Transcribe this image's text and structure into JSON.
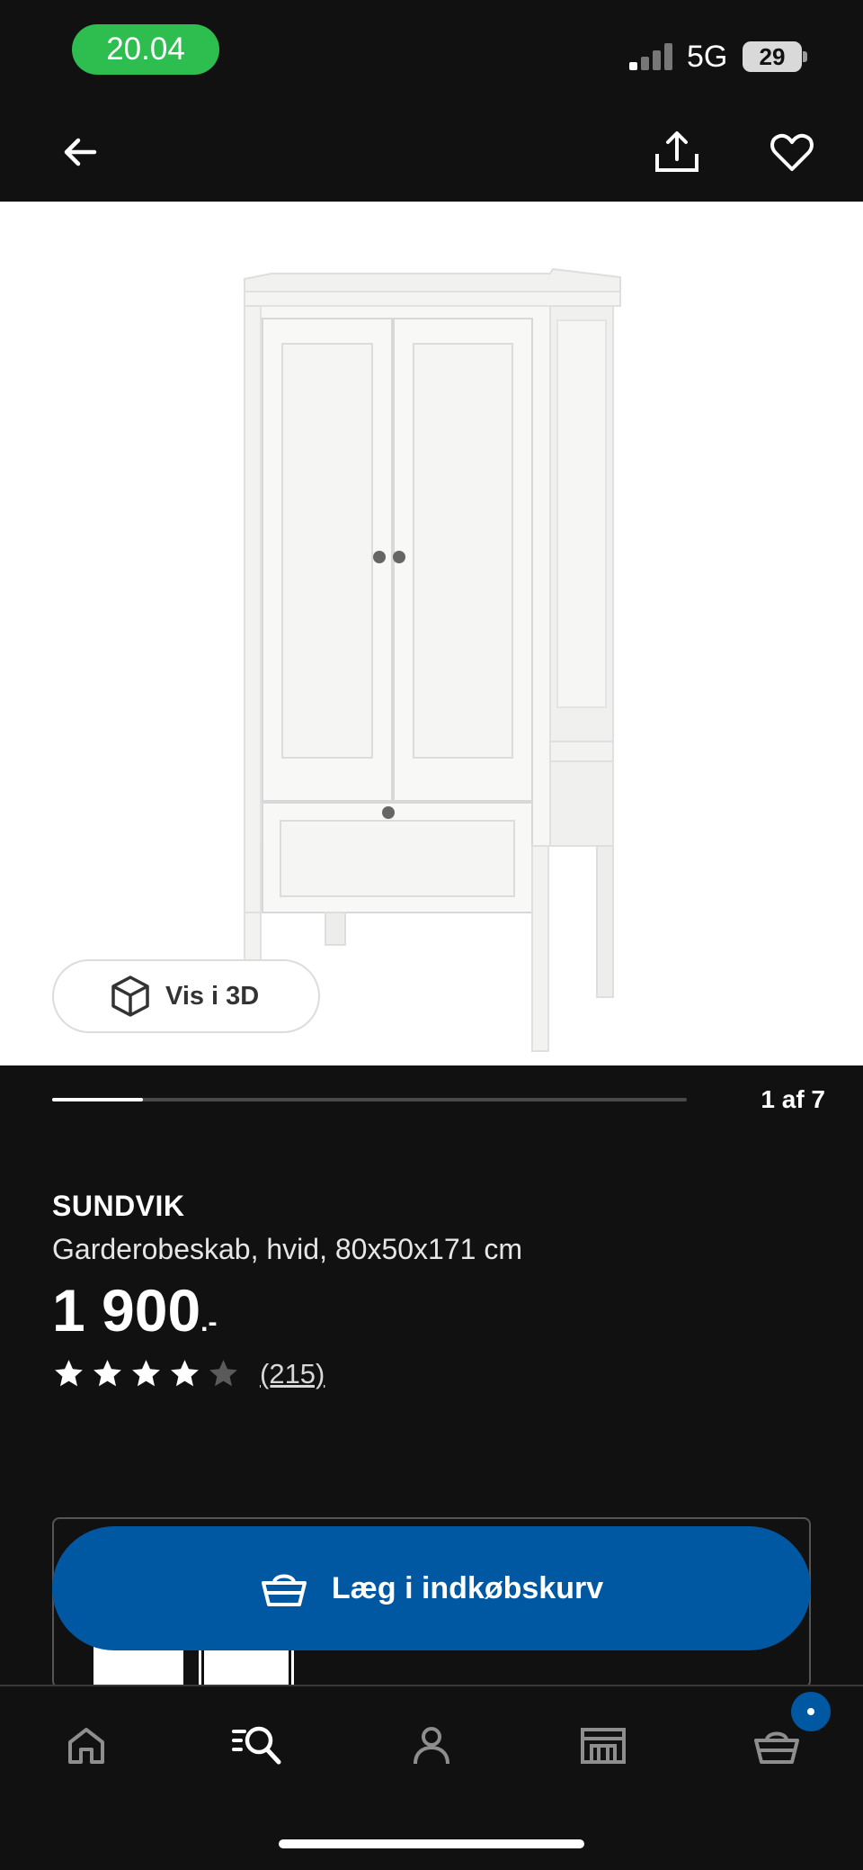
{
  "status_bar": {
    "time": "20.04",
    "network": "5G",
    "battery": "29",
    "time_pill_color": "#2ebd4f"
  },
  "header": {
    "back_icon": "arrow-left-icon",
    "share_icon": "share-icon",
    "favorite_icon": "heart-icon"
  },
  "gallery": {
    "view_3d_label": "Vis i 3D",
    "view_3d_icon": "cube-icon",
    "page_indicator": "1 af 7",
    "current_page": 1,
    "total_pages": 7
  },
  "product": {
    "name": "SUNDVIK",
    "description": "Garderobeskab, hvid, 80x50x171 cm",
    "price": "1 900",
    "price_suffix": ".-",
    "rating": 4,
    "rating_max": 5,
    "review_count": "(215)"
  },
  "cart": {
    "add_label": "Læg i indkøbskurv",
    "button_color": "#0058a3",
    "cart_icon": "basket-icon"
  },
  "bottom_nav": {
    "items": [
      {
        "icon": "home-icon"
      },
      {
        "icon": "search-icon"
      },
      {
        "icon": "user-icon"
      },
      {
        "icon": "store-icon"
      },
      {
        "icon": "basket-icon"
      }
    ],
    "active_index": 1
  }
}
